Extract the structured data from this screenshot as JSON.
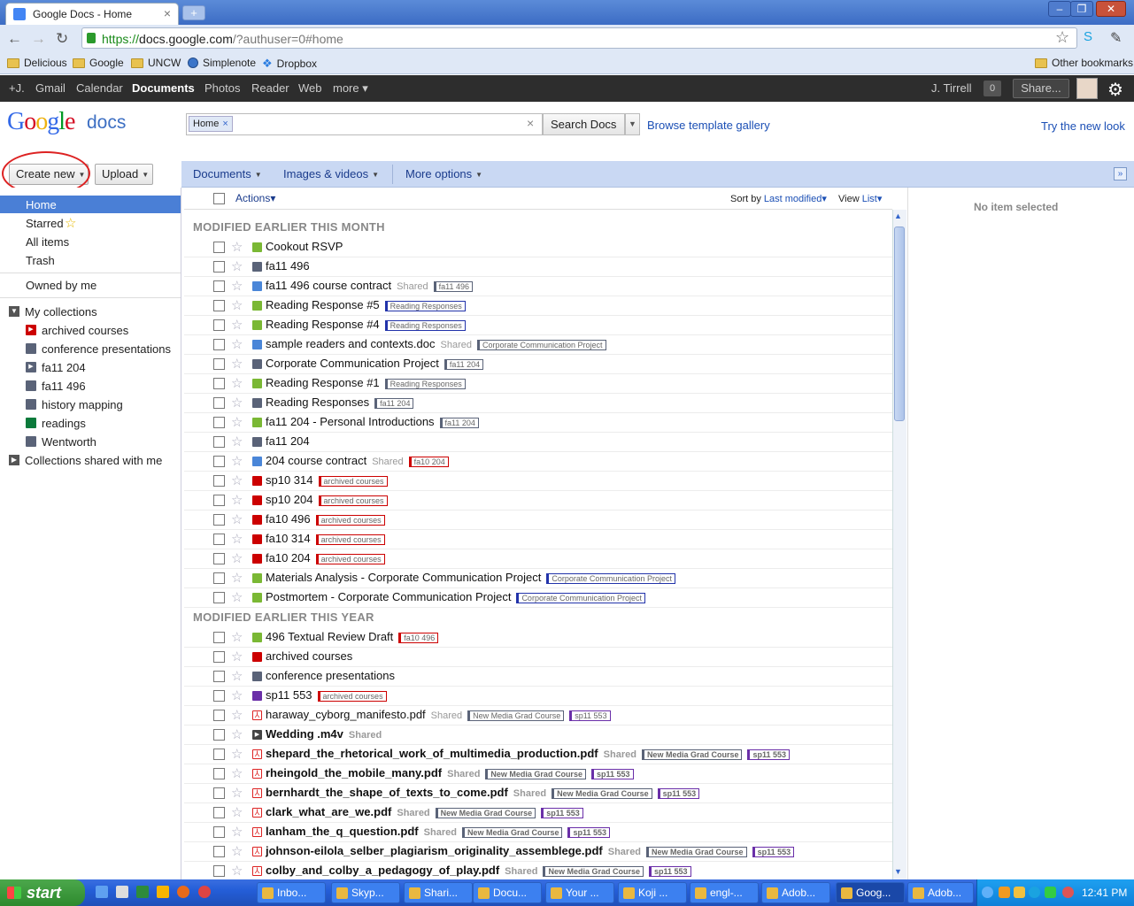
{
  "browser": {
    "tab_title": "Google Docs - Home",
    "url_scheme": "https://",
    "url_host": "docs.google.com",
    "url_rest": "/?authuser=0#home",
    "bookmarks": [
      "Delicious",
      "Google",
      "UNCW",
      "Simplenote",
      "Dropbox"
    ],
    "other_bookmarks": "Other bookmarks"
  },
  "gbar": {
    "items": [
      "+J.",
      "Gmail",
      "Calendar",
      "Documents",
      "Photos",
      "Reader",
      "Web",
      "more ▾"
    ],
    "user": "J. Tirrell",
    "notif_count": "0",
    "share": "Share..."
  },
  "header": {
    "logo": [
      "G",
      "o",
      "o",
      "g",
      "l",
      "e"
    ],
    "logo_product": "docs",
    "search_chip": "Home",
    "search_button": "Search Docs",
    "browse_link": "Browse template gallery",
    "try_link": "Try the new look"
  },
  "toolbar": {
    "create_new": "Create new",
    "upload": "Upload",
    "menus": [
      "Documents",
      "Images & videos",
      "More options"
    ],
    "actions": "Actions",
    "sort_by": "Sort by",
    "sort_value": "Last modified",
    "view": "View",
    "view_value": "List"
  },
  "sidebar": {
    "nav": [
      "Home",
      "Starred",
      "All items",
      "Trash"
    ],
    "owned": "Owned by me",
    "my_collections": "My collections",
    "collections": [
      {
        "label": "archived courses",
        "color": "#cc0000"
      },
      {
        "label": "conference presentations",
        "color": "#5a6378"
      },
      {
        "label": "fa11 204",
        "color": "#5a6378"
      },
      {
        "label": "fa11 496",
        "color": "#5a6378"
      },
      {
        "label": "history mapping",
        "color": "#5a6378"
      },
      {
        "label": "readings",
        "color": "#0b7a3b"
      },
      {
        "label": "Wentworth",
        "color": "#5a6378"
      }
    ],
    "shared_collections": "Collections shared with me"
  },
  "list": {
    "section1": "MODIFIED EARLIER THIS MONTH",
    "section2": "MODIFIED EARLIER THIS YEAR",
    "rows1": [
      {
        "title": "Cookout RSVP",
        "icon": "#7ab834",
        "shared": "",
        "tags": []
      },
      {
        "title": "fa11 496",
        "icon": "#5a6378",
        "shared": "",
        "tags": []
      },
      {
        "title": "fa11 496 course contract",
        "icon": "#4a86d8",
        "shared": "Shared",
        "tags": [
          {
            "t": "fa11 496",
            "c": "#5a6378"
          }
        ]
      },
      {
        "title": "Reading Response #5",
        "icon": "#7ab834",
        "shared": "",
        "tags": [
          {
            "t": "Reading Responses",
            "c": "#2233aa"
          }
        ]
      },
      {
        "title": "Reading Response #4",
        "icon": "#7ab834",
        "shared": "",
        "tags": [
          {
            "t": "Reading Responses",
            "c": "#2233aa"
          }
        ]
      },
      {
        "title": "sample readers and contexts.doc",
        "icon": "#4a86d8",
        "shared": "Shared",
        "tags": [
          {
            "t": "Corporate Communication Project",
            "c": "#5a6378"
          }
        ]
      },
      {
        "title": "Corporate Communication Project",
        "icon": "#5a6378",
        "shared": "",
        "tags": [
          {
            "t": "fa11 204",
            "c": "#5a6378"
          }
        ]
      },
      {
        "title": "Reading Response #1",
        "icon": "#7ab834",
        "shared": "",
        "tags": [
          {
            "t": "Reading Responses",
            "c": "#5a6378"
          }
        ]
      },
      {
        "title": "Reading Responses",
        "icon": "#5a6378",
        "shared": "",
        "tags": [
          {
            "t": "fa11 204",
            "c": "#5a6378"
          }
        ]
      },
      {
        "title": "fa11 204 - Personal Introductions",
        "icon": "#7ab834",
        "shared": "",
        "tags": [
          {
            "t": "fa11 204",
            "c": "#5a6378"
          }
        ]
      },
      {
        "title": "fa11 204",
        "icon": "#5a6378",
        "shared": "",
        "tags": []
      },
      {
        "title": "204 course contract",
        "icon": "#4a86d8",
        "shared": "Shared",
        "tags": [
          {
            "t": "fa10 204",
            "c": "#cc0000"
          }
        ]
      },
      {
        "title": "sp10 314",
        "icon": "#cc0000",
        "shared": "",
        "tags": [
          {
            "t": "archived courses",
            "c": "#cc0000"
          }
        ]
      },
      {
        "title": "sp10 204",
        "icon": "#cc0000",
        "shared": "",
        "tags": [
          {
            "t": "archived courses",
            "c": "#cc0000"
          }
        ]
      },
      {
        "title": "fa10 496",
        "icon": "#cc0000",
        "shared": "",
        "tags": [
          {
            "t": "archived courses",
            "c": "#cc0000"
          }
        ]
      },
      {
        "title": "fa10 314",
        "icon": "#cc0000",
        "shared": "",
        "tags": [
          {
            "t": "archived courses",
            "c": "#cc0000"
          }
        ]
      },
      {
        "title": "fa10 204",
        "icon": "#cc0000",
        "shared": "",
        "tags": [
          {
            "t": "archived courses",
            "c": "#cc0000"
          }
        ]
      },
      {
        "title": "Materials Analysis - Corporate Communication Project",
        "icon": "#7ab834",
        "shared": "",
        "tags": [
          {
            "t": "Corporate Communication Project",
            "c": "#2233aa"
          }
        ]
      },
      {
        "title": "Postmortem - Corporate Communication Project",
        "icon": "#7ab834",
        "shared": "",
        "tags": [
          {
            "t": "Corporate Communication Project",
            "c": "#2233aa"
          }
        ]
      }
    ],
    "rows2": [
      {
        "title": "496 Textual Review Draft",
        "icon": "#7ab834",
        "shared": "",
        "bold": false,
        "tags": [
          {
            "t": "fa10 496",
            "c": "#cc0000"
          }
        ]
      },
      {
        "title": "archived courses",
        "icon": "#cc0000",
        "shared": "",
        "bold": false,
        "tags": []
      },
      {
        "title": "conference presentations",
        "icon": "#5a6378",
        "shared": "",
        "bold": false,
        "tags": []
      },
      {
        "title": "sp11 553",
        "icon": "#6a2fa8",
        "shared": "",
        "bold": false,
        "tags": [
          {
            "t": "archived courses",
            "c": "#cc0000"
          }
        ]
      },
      {
        "title": "haraway_cyborg_manifesto.pdf",
        "icon": "pdf",
        "shared": "Shared",
        "bold": false,
        "tags": [
          {
            "t": "New Media Grad Course",
            "c": "#5a6378"
          },
          {
            "t": "sp11 553",
            "c": "#6a2fa8"
          }
        ]
      },
      {
        "title": "Wedding .m4v",
        "icon": "vid",
        "shared": "Shared",
        "bold": true,
        "tags": []
      },
      {
        "title": "shepard_the_rhetorical_work_of_multimedia_production.pdf",
        "icon": "pdf",
        "shared": "Shared",
        "bold": true,
        "tags": [
          {
            "t": "New Media Grad Course",
            "c": "#5a6378"
          },
          {
            "t": "sp11 553",
            "c": "#6a2fa8"
          }
        ]
      },
      {
        "title": "rheingold_the_mobile_many.pdf",
        "icon": "pdf",
        "shared": "Shared",
        "bold": true,
        "tags": [
          {
            "t": "New Media Grad Course",
            "c": "#5a6378"
          },
          {
            "t": "sp11 553",
            "c": "#6a2fa8"
          }
        ]
      },
      {
        "title": "bernhardt_the_shape_of_texts_to_come.pdf",
        "icon": "pdf",
        "shared": "Shared",
        "bold": true,
        "tags": [
          {
            "t": "New Media Grad Course",
            "c": "#5a6378"
          },
          {
            "t": "sp11 553",
            "c": "#6a2fa8"
          }
        ]
      },
      {
        "title": "clark_what_are_we.pdf",
        "icon": "pdf",
        "shared": "Shared",
        "bold": true,
        "tags": [
          {
            "t": "New Media Grad Course",
            "c": "#5a6378"
          },
          {
            "t": "sp11 553",
            "c": "#6a2fa8"
          }
        ]
      },
      {
        "title": "lanham_the_q_question.pdf",
        "icon": "pdf",
        "shared": "Shared",
        "bold": true,
        "tags": [
          {
            "t": "New Media Grad Course",
            "c": "#5a6378"
          },
          {
            "t": "sp11 553",
            "c": "#6a2fa8"
          }
        ]
      },
      {
        "title": "johnson-eilola_selber_plagiarism_originality_assemblege.pdf",
        "icon": "pdf",
        "shared": "Shared",
        "bold": true,
        "tags": [
          {
            "t": "New Media Grad Course",
            "c": "#5a6378"
          },
          {
            "t": "sp11 553",
            "c": "#6a2fa8"
          }
        ]
      },
      {
        "title": "colby_and_colby_a_pedagogy_of_play.pdf",
        "icon": "pdf",
        "shared": "Shared",
        "bold": true,
        "tags": [
          {
            "t": "New Media Grad Course",
            "c": "#5a6378"
          },
          {
            "t": "sp11 553",
            "c": "#6a2fa8"
          }
        ]
      }
    ]
  },
  "detail": {
    "empty": "No item selected"
  },
  "taskbar": {
    "start": "start",
    "tasks": [
      "Inbo...",
      "Skyp...",
      "Shari...",
      "Docu...",
      "Your ...",
      "Koji ...",
      "engl-...",
      "Adob...",
      "Goog...",
      "Adob..."
    ],
    "clock": "12:41 PM"
  }
}
